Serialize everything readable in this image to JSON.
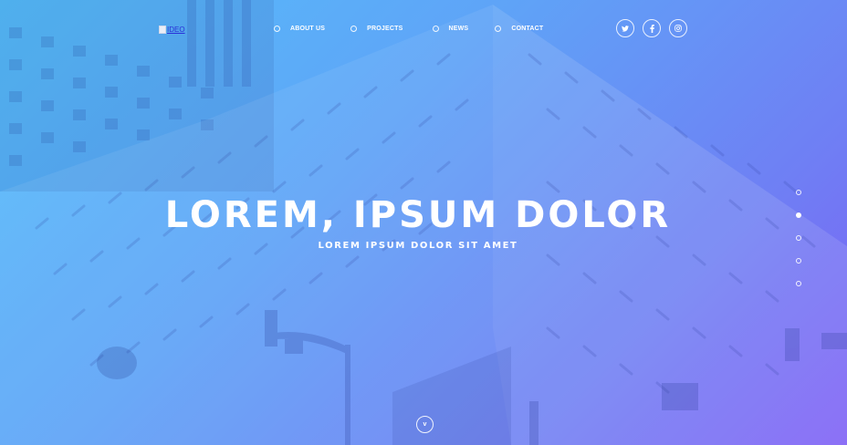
{
  "logo": {
    "alt_text": "IDEO"
  },
  "nav": {
    "items": [
      {
        "label": "ABOUT US"
      },
      {
        "label": "PROJECTS"
      },
      {
        "label": "NEWS"
      },
      {
        "label": "CONTACT"
      }
    ]
  },
  "social": {
    "icons": [
      "twitter-icon",
      "facebook-icon",
      "instagram-icon"
    ]
  },
  "hero": {
    "title": "LOREM, IPSUM DOLOR",
    "subtitle": "LOREM IPSUM DOLOR SIT AMET",
    "scroll_label": "v"
  },
  "pager": {
    "count": 5,
    "active_index": 1
  },
  "colors": {
    "gradient_start": "#55c0fb",
    "gradient_end": "#7d5ef6",
    "text": "#ffffff"
  }
}
